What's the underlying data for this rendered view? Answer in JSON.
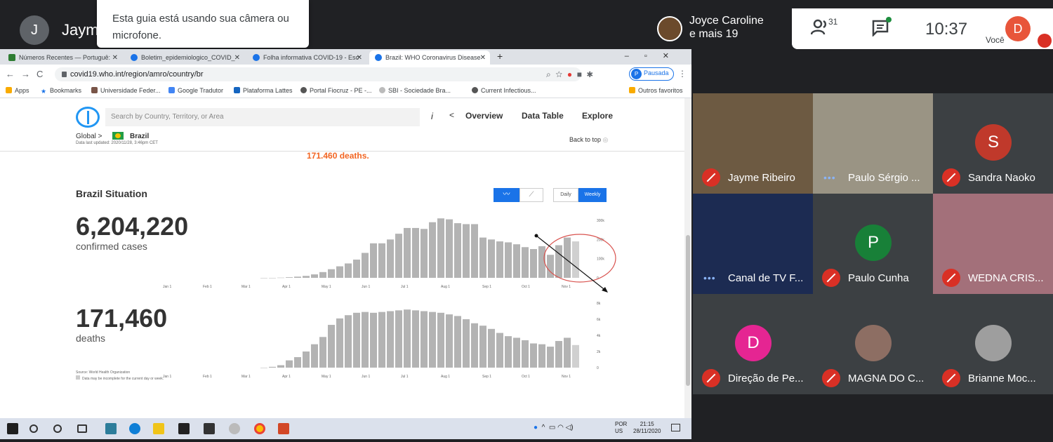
{
  "meet": {
    "presenter_initial": "J",
    "presenter_name": "Jaym",
    "toast_text": "Esta guia está usando sua câmera ou microfone.",
    "joyce_line1": "Joyce Caroline",
    "joyce_line2": "e mais 19",
    "people_count": "31",
    "clock": "10:37",
    "you_initial": "D",
    "you_label": "Você"
  },
  "browser": {
    "tabs": [
      {
        "label": "Números Recentes — Portuguê:",
        "color": "#2e7d32"
      },
      {
        "label": "Boletim_epidemiologico_COVID_",
        "color": "#1a73e8"
      },
      {
        "label": "Folha informativa COVID-19 - Esc",
        "color": "#1a73e8"
      },
      {
        "label": "Brazil: WHO Coronavirus Disease",
        "color": "#1a73e8"
      }
    ],
    "url": "covid19.who.int/region/amro/country/br",
    "pausada": "Pausada",
    "pausada_initial": "P",
    "bookmarks": [
      "Apps",
      "Bookmarks",
      "Universidade Feder...",
      "Google Tradutor",
      "Plataforma Lattes",
      "Portal Fiocruz - PE -...",
      "SBI - Sociedade Bra...",
      "Current Infectious...",
      "Outros favoritos"
    ]
  },
  "page": {
    "search_placeholder": "Search by Country, Territory, or Area",
    "nav": [
      "Overview",
      "Data Table",
      "Explore"
    ],
    "crumb_global": "Global",
    "crumb_country": "Brazil",
    "updated": "Data last updated: 2020/11/28, 3:46pm CET",
    "back_to_top": "Back to top",
    "deaths_top": "171.460 deaths.",
    "situation_title": "Brazil Situation",
    "cases_num": "6,204,220",
    "cases_label": "confirmed cases",
    "deaths_num": "171,460",
    "deaths_label": "deaths",
    "btn_daily": "Daily",
    "btn_weekly": "Weekly",
    "source": "Source: World Health Organization",
    "source_note": "Data may be incomplete for the current day or week."
  },
  "chart_data": [
    {
      "type": "bar",
      "title": "",
      "x_ticks": [
        "Jan 1",
        "Feb 1",
        "Mar 1",
        "Apr 1",
        "May 1",
        "Jun 1",
        "Jul 1",
        "Aug 1",
        "Sep 1",
        "Oct 1",
        "Nov 1"
      ],
      "y_ticks": [
        "300k",
        "200k",
        "100k",
        "0"
      ],
      "ylim": [
        0,
        300000
      ],
      "values": [
        0,
        0,
        1000,
        3000,
        6000,
        10000,
        18000,
        30000,
        45000,
        60000,
        75000,
        95000,
        130000,
        180000,
        180000,
        200000,
        230000,
        260000,
        260000,
        255000,
        290000,
        310000,
        305000,
        285000,
        280000,
        280000,
        210000,
        200000,
        190000,
        185000,
        175000,
        160000,
        150000,
        165000,
        120000,
        170000,
        210000,
        190000
      ]
    },
    {
      "type": "bar",
      "title": "",
      "x_ticks": [
        "Jan 1",
        "Feb 1",
        "Mar 1",
        "Apr 1",
        "May 1",
        "Jun 1",
        "Jul 1",
        "Aug 1",
        "Sep 1",
        "Oct 1",
        "Nov 1"
      ],
      "y_ticks": [
        "8k",
        "6k",
        "4k",
        "2k",
        "0"
      ],
      "ylim": [
        0,
        8000
      ],
      "values": [
        0,
        100,
        300,
        900,
        1300,
        2000,
        2900,
        3800,
        5300,
        6100,
        6500,
        6800,
        6900,
        6800,
        6900,
        7000,
        7100,
        7200,
        7100,
        7000,
        6900,
        6800,
        6600,
        6400,
        6000,
        5500,
        5200,
        4800,
        4300,
        3900,
        3700,
        3400,
        3000,
        2900,
        2600,
        3300,
        3700,
        2800
      ]
    }
  ],
  "participants": [
    {
      "name": "Jayme Ribeiro",
      "bg": "#6d5a42",
      "icon": "mic-off"
    },
    {
      "name": "Paulo Sérgio ...",
      "bg": "#9a9484",
      "icon": "dots"
    },
    {
      "name": "Sandra Naoko",
      "bg": "#3c4043",
      "icon": "mic-off",
      "avatar": "S",
      "avatar_color": "#c0392b"
    },
    {
      "name": "Canal de TV F...",
      "bg": "#1c2b52",
      "icon": "dots"
    },
    {
      "name": "Paulo Cunha",
      "bg": "#3c4043",
      "icon": "mic-off",
      "avatar": "P",
      "avatar_color": "#188038"
    },
    {
      "name": "WEDNA CRIS...",
      "bg": "#a3707a",
      "icon": "mic-off"
    },
    {
      "name": "Direção de Pe...",
      "bg": "#3c4043",
      "icon": "mic-off",
      "avatar": "D",
      "avatar_color": "#e52592"
    },
    {
      "name": "MAGNA DO C...",
      "bg": "#3c4043",
      "icon": "mic-off",
      "avatar": " ",
      "avatar_color": "#8d6e63"
    },
    {
      "name": "Brianne Moc...",
      "bg": "#3c4043",
      "icon": "mic-off",
      "avatar": " ",
      "avatar_color": "#9e9e9e"
    }
  ],
  "taskbar": {
    "lang1": "POR",
    "lang2": "US",
    "time": "21:15",
    "date": "28/11/2020"
  }
}
